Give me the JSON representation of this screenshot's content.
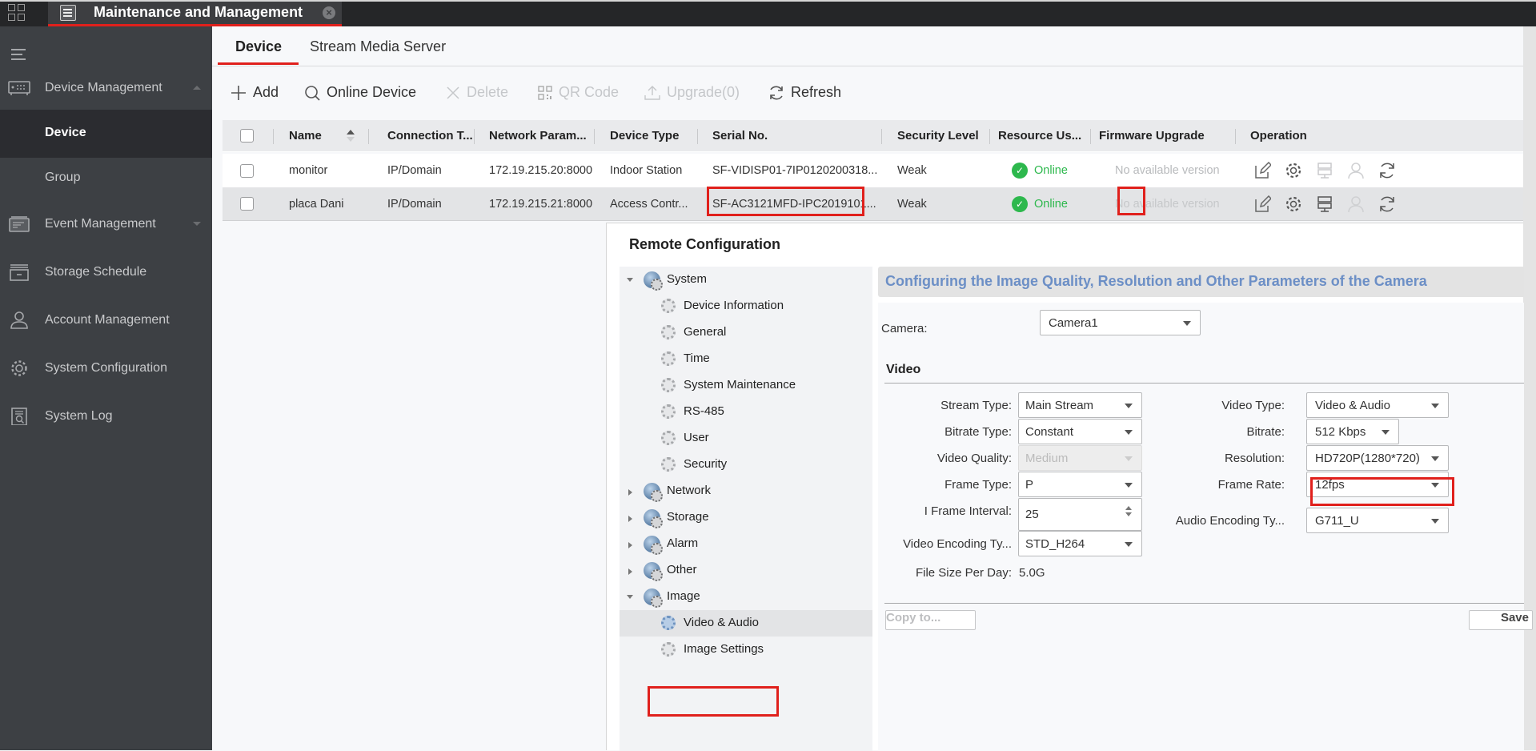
{
  "topbar": {
    "tab_title": "Maintenance and Management",
    "apps_icon": "grid-icon",
    "close_icon": "close-circle-icon"
  },
  "sidebar": {
    "toggle_icon": "menu-icon",
    "items": [
      {
        "label": "Device Management",
        "icon": "device-icon",
        "expanded": true
      },
      {
        "label": "Device",
        "active": true
      },
      {
        "label": "Group"
      },
      {
        "label": "Event Management",
        "icon": "event-icon",
        "expanded": false
      },
      {
        "label": "Storage Schedule",
        "icon": "storage-icon"
      },
      {
        "label": "Account Management",
        "icon": "user-icon"
      },
      {
        "label": "System Configuration",
        "icon": "gear-icon"
      },
      {
        "label": "System Log",
        "icon": "log-icon"
      }
    ]
  },
  "tabs": [
    {
      "label": "Device",
      "active": true
    },
    {
      "label": "Stream Media Server",
      "active": false
    }
  ],
  "toolbar": {
    "add": "Add",
    "online_device": "Online Device",
    "delete": "Delete",
    "qr_code": "QR Code",
    "upgrade": "Upgrade(0)",
    "refresh": "Refresh"
  },
  "table": {
    "columns": [
      "Name",
      "Connection T...",
      "Network Param...",
      "Device Type",
      "Serial No.",
      "Security Level",
      "Resource Us...",
      "Firmware Upgrade",
      "Operation"
    ],
    "rows": [
      {
        "name": "monitor",
        "connection": "IP/Domain",
        "network": "172.19.215.20:8000",
        "device_type": "Indoor Station",
        "serial": "SF-VIDISP01-7IP0120200318...",
        "security": "Weak",
        "status": "Online",
        "firmware": "No available version",
        "selected": false
      },
      {
        "name": "placa Dani",
        "connection": "IP/Domain",
        "network": "172.19.215.21:8000",
        "device_type": "Access Contr...",
        "serial": "SF-AC3121MFD-IPC2019101...",
        "security": "Weak",
        "status": "Online",
        "firmware": "No available version",
        "selected": true
      }
    ],
    "operation_icons": [
      "edit-icon",
      "settings-icon",
      "remote-server-icon",
      "user-icon",
      "refresh-icon"
    ]
  },
  "remote_config": {
    "title": "Remote Configuration",
    "tree": [
      {
        "label": "System",
        "level": 1,
        "expanded": true
      },
      {
        "label": "Device Information",
        "level": 2
      },
      {
        "label": "General",
        "level": 2
      },
      {
        "label": "Time",
        "level": 2
      },
      {
        "label": "System Maintenance",
        "level": 2
      },
      {
        "label": "RS-485",
        "level": 2
      },
      {
        "label": "User",
        "level": 2
      },
      {
        "label": "Security",
        "level": 2
      },
      {
        "label": "Network",
        "level": 1,
        "expanded": false
      },
      {
        "label": "Storage",
        "level": 1,
        "expanded": false
      },
      {
        "label": "Alarm",
        "level": 1,
        "expanded": false
      },
      {
        "label": "Other",
        "level": 1,
        "expanded": false
      },
      {
        "label": "Image",
        "level": 1,
        "expanded": true
      },
      {
        "label": "Video & Audio",
        "level": 2,
        "selected": true
      },
      {
        "label": "Image Settings",
        "level": 2
      }
    ],
    "panel_title": "Configuring the Image Quality, Resolution and Other Parameters of the Camera",
    "camera_label": "Camera:",
    "camera_value": "Camera1",
    "video_section": "Video",
    "fields_left": [
      {
        "label": "Stream Type:",
        "value": "Main Stream"
      },
      {
        "label": "Bitrate Type:",
        "value": "Constant"
      },
      {
        "label": "Video Quality:",
        "value": "Medium",
        "disabled": true
      },
      {
        "label": "Frame Type:",
        "value": "P"
      },
      {
        "label": "I Frame Interval:",
        "value": "25"
      },
      {
        "label": "Video Encoding Ty...",
        "value": "STD_H264"
      }
    ],
    "file_size_label": "File Size Per Day:",
    "file_size_value": "5.0G",
    "fields_right": [
      {
        "label": "Video Type:",
        "value": "Video & Audio"
      },
      {
        "label": "Bitrate:",
        "value": "512 Kbps"
      },
      {
        "label": "Resolution:",
        "value": "HD720P(1280*720)"
      },
      {
        "label": "Frame Rate:",
        "value": "12fps"
      },
      {
        "label": "Audio Encoding Ty...",
        "value": "G711_U"
      }
    ],
    "copy_to": "Copy to...",
    "save": "Save"
  },
  "colors": {
    "accent_red": "#e0201c",
    "online_green": "#2db84d",
    "panel_title_blue": "#6c8fc6",
    "sidebar_bg": "#3d4044"
  }
}
